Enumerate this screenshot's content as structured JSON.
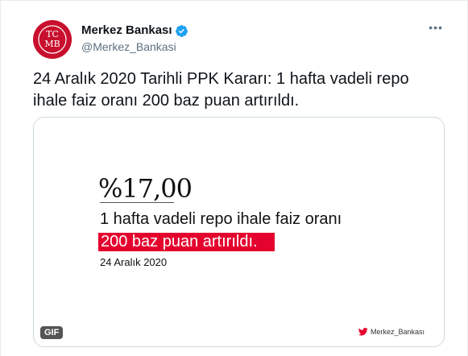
{
  "account": {
    "display_name": "Merkez Bankası",
    "handle": "@Merkez_Bankasi",
    "avatar_text": "TCMB"
  },
  "tweet": {
    "text": "24 Aralık 2020 Tarihli PPK Kararı: 1 hafta vadeli repo ihale faiz oranı 200 baz puan artırıldı.",
    "more_label": "•••"
  },
  "media": {
    "rate": "%17,00",
    "description": "1 hafta vadeli repo ihale faiz oranı",
    "highlight": "200 baz puan artırıldı.",
    "date": "24 Aralık 2020",
    "gif_label": "GIF",
    "credit": "Merkez_Bankası"
  },
  "colors": {
    "brand_red": "#c8102e",
    "highlight_red": "#e4032e",
    "verified_blue": "#1da1f2",
    "twitter_red": "#e4032e"
  }
}
